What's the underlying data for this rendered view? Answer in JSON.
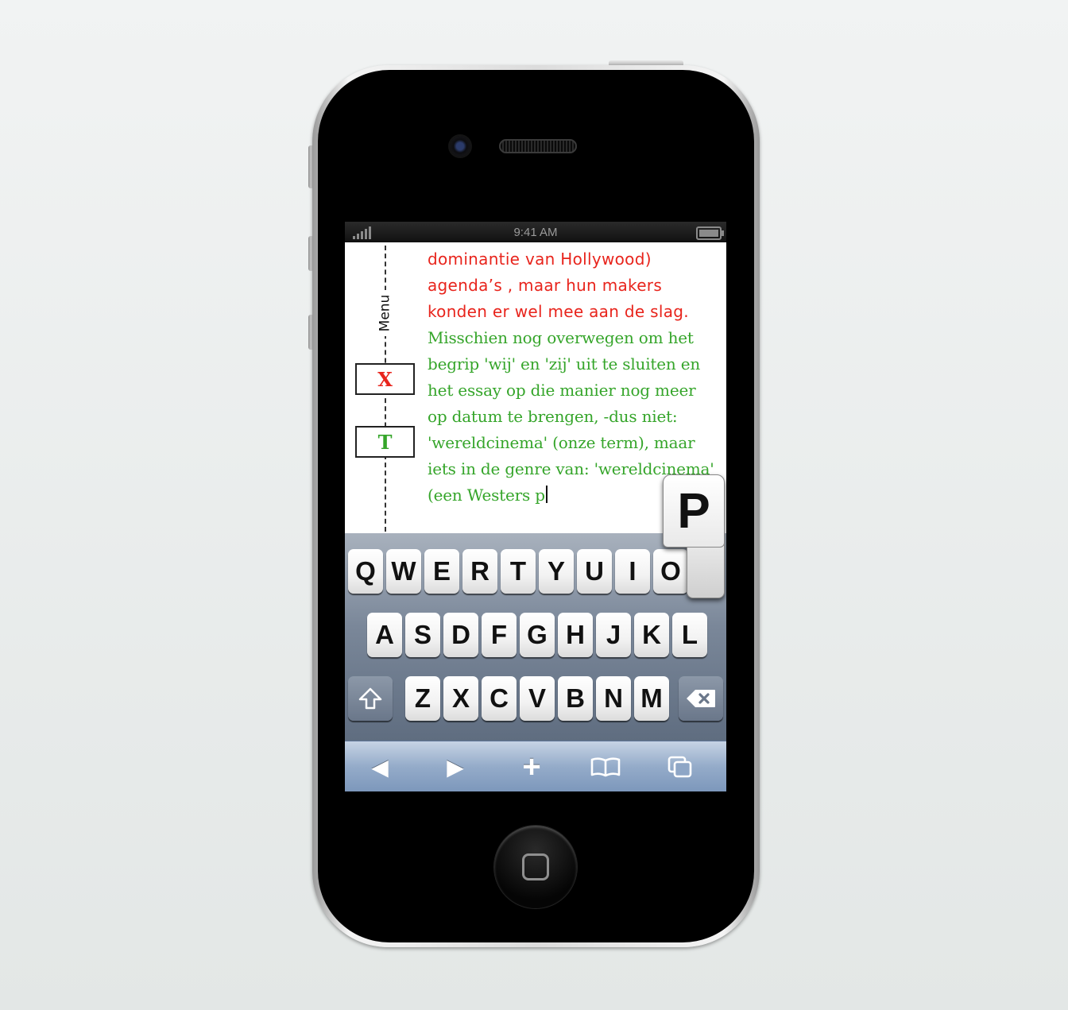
{
  "status_bar": {
    "time": "9:41 AM"
  },
  "sidebar": {
    "menu_label": "Menu",
    "tool_x_label": "X",
    "tool_t_label": "T"
  },
  "document": {
    "red_lines": [
      "dominantie van Hollywood)",
      "agenda’s , maar hun makers",
      "konden er wel mee aan de slag."
    ],
    "green_lines": [
      "Misschien nog overwegen om het",
      "begrip 'wij' en 'zij' uit te sluiten en",
      "het essay op die manier nog meer",
      "op datum te brengen, -dus niet:",
      "'wereldcinema' (onze term), maar",
      "iets in de genre van: 'wereldcinema'",
      "(een Westers p"
    ]
  },
  "keyboard": {
    "row1": [
      "Q",
      "W",
      "E",
      "R",
      "T",
      "Y",
      "U",
      "I",
      "O"
    ],
    "row2": [
      "A",
      "S",
      "D",
      "F",
      "G",
      "H",
      "J",
      "K",
      "L"
    ],
    "row3": [
      "Z",
      "X",
      "C",
      "V",
      "B",
      "N",
      "M"
    ],
    "pressed_key": "P"
  },
  "toolbar": {
    "back": "◀",
    "forward": "▶",
    "add": "+"
  },
  "colors": {
    "red_text": "#e8241c",
    "green_text": "#35a52a"
  }
}
